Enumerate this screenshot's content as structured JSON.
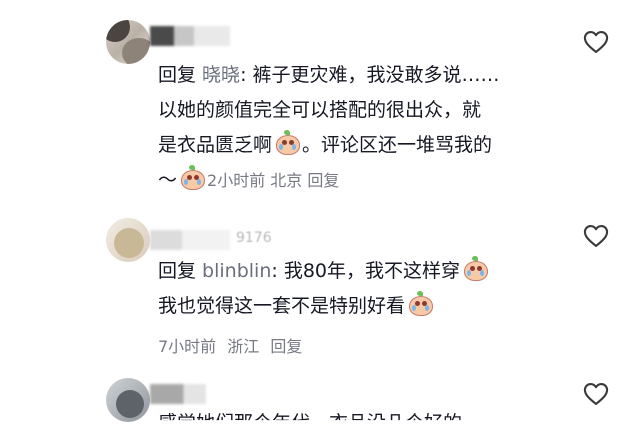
{
  "comments": [
    {
      "reply_prefix": "回复 ",
      "reply_user": "晓晓",
      "line1": ": 裤子更灾难，我没敢多说……",
      "line2": "以她的颜值完全可以搭配的很出众，就",
      "line3_before": "是衣品匮乏啊",
      "line3_after": "。评论区还一堆骂我的",
      "line4_start": "～",
      "time": "2小时前",
      "location": "北京",
      "reply_label": "回复"
    },
    {
      "username_extra": "9176",
      "reply_prefix": "回复 ",
      "reply_user": "blinblin",
      "line1": ": 我80年，我不这样穿",
      "line2": "我也觉得这一套不是特别好看",
      "time": "7小时前",
      "location": "浙江",
      "reply_label": "回复"
    },
    {
      "partial_text": "感觉她们那个年代，衣品没几个好的"
    }
  ],
  "icons": {
    "like": "heart-outline-icon",
    "emoji": "crying-emoji-icon"
  }
}
